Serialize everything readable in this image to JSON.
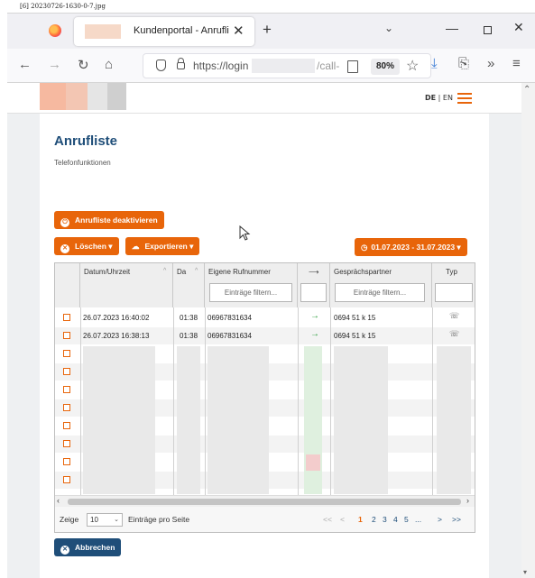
{
  "file_label": "[6] 20230726-1630-0-7.jpg",
  "browser": {
    "tab_title": "Kundenportal - Anrufli",
    "tab_close": "✕",
    "new_tab": "+",
    "tab_list": "⌄",
    "window_min": "—",
    "window_close": "✕",
    "nav_back": "←",
    "nav_forward": "→",
    "nav_reload": "↻",
    "nav_home": "⌂",
    "url_visible": "https://login",
    "url_tail": "/call-",
    "zoom": "80%",
    "toolbar_download": "⤓",
    "toolbar_extension": "⎘",
    "toolbar_overflow": "»",
    "toolbar_menu": "≡"
  },
  "header": {
    "lang_de": "DE",
    "lang_sep": "|",
    "lang_en": "EN"
  },
  "page": {
    "title": "Anrufliste",
    "subtitle": "Telefonfunktionen"
  },
  "actions": {
    "deactivate_label": "Anrufliste deaktivieren",
    "delete_label": "Löschen ▾",
    "export_label": "Exportieren ▾",
    "date_range_label": "01.07.2023 - 31.07.2023 ▾",
    "cancel_label": "Abbrechen"
  },
  "table": {
    "columns": [
      {
        "label": "",
        "filter": null
      },
      {
        "label": "Datum/Uhrzeit",
        "filter": null
      },
      {
        "label": "Da",
        "filter": null
      },
      {
        "label": "Eigene Rufnummer",
        "filter": "Einträge filtern..."
      },
      {
        "label": "⟶",
        "filter": ""
      },
      {
        "label": "Gesprächspartner",
        "filter": "Einträge filtern..."
      },
      {
        "label": "Typ",
        "filter": ""
      }
    ],
    "rows": [
      {
        "datetime": "26.07.2023 16:40:02",
        "duration": "01:38",
        "own_number": "06967831634",
        "direction": "→",
        "partner": "0694 51 k 15",
        "type": "📞"
      },
      {
        "datetime": "26.07.2023 16:38:13",
        "duration": "01:38",
        "own_number": "06967831634",
        "direction": "→",
        "partner": "0694 51 k 15",
        "type": "📞"
      }
    ],
    "redacted_row_count": 9
  },
  "footer": {
    "show_label": "Zeige",
    "per_page_value": "10",
    "per_page_suffix": "Einträge pro Seite",
    "pager": [
      "<<",
      "<",
      "1",
      "2",
      "3",
      "4",
      "5",
      "...",
      ">",
      ">>"
    ],
    "current_page": "1"
  },
  "colors": {
    "accent": "#e8650a",
    "navy": "#1f4e79",
    "green_arrow": "#2e9e3e"
  }
}
